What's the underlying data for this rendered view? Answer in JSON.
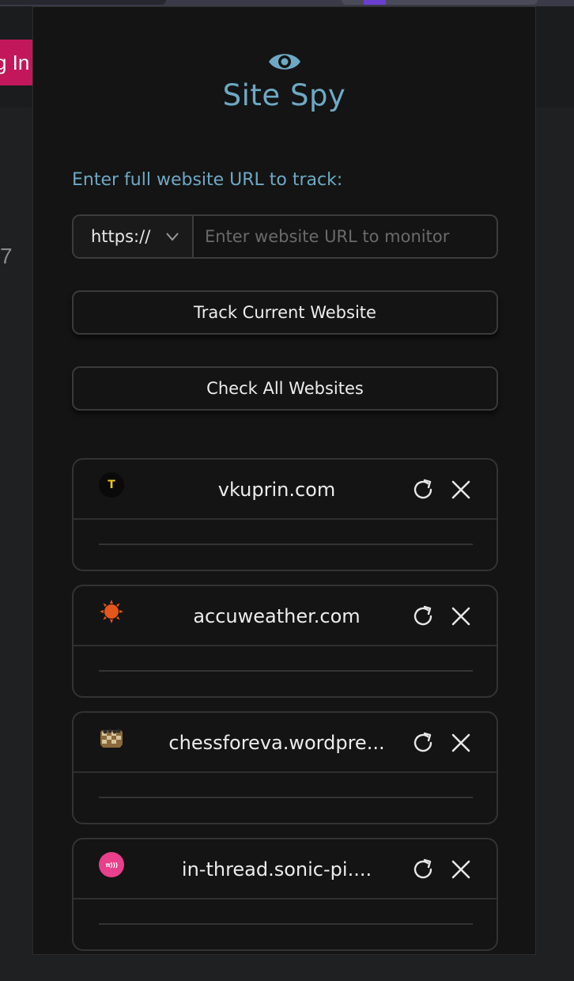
{
  "background": {
    "login_text": "g In",
    "side_number": "7"
  },
  "app": {
    "title": "Site Spy",
    "logo_icon": "eye-icon",
    "accent_color": "#6ea9c4"
  },
  "url_form": {
    "label": "Enter full website URL to track:",
    "protocol_selected": "https://",
    "input_placeholder": "Enter website URL to monitor",
    "input_value": ""
  },
  "buttons": {
    "track_current": "Track Current Website",
    "check_all": "Check All Websites"
  },
  "sites": [
    {
      "name": "vkuprin.com",
      "favicon": "letter-t-icon",
      "favicon_text": "T"
    },
    {
      "name": "accuweather.com",
      "favicon": "sun-icon"
    },
    {
      "name": "chessforeva.wordpre...",
      "favicon": "chessboard-icon"
    },
    {
      "name": "in-thread.sonic-pi....",
      "favicon": "sonic-pi-icon",
      "favicon_text": "π)))"
    }
  ]
}
